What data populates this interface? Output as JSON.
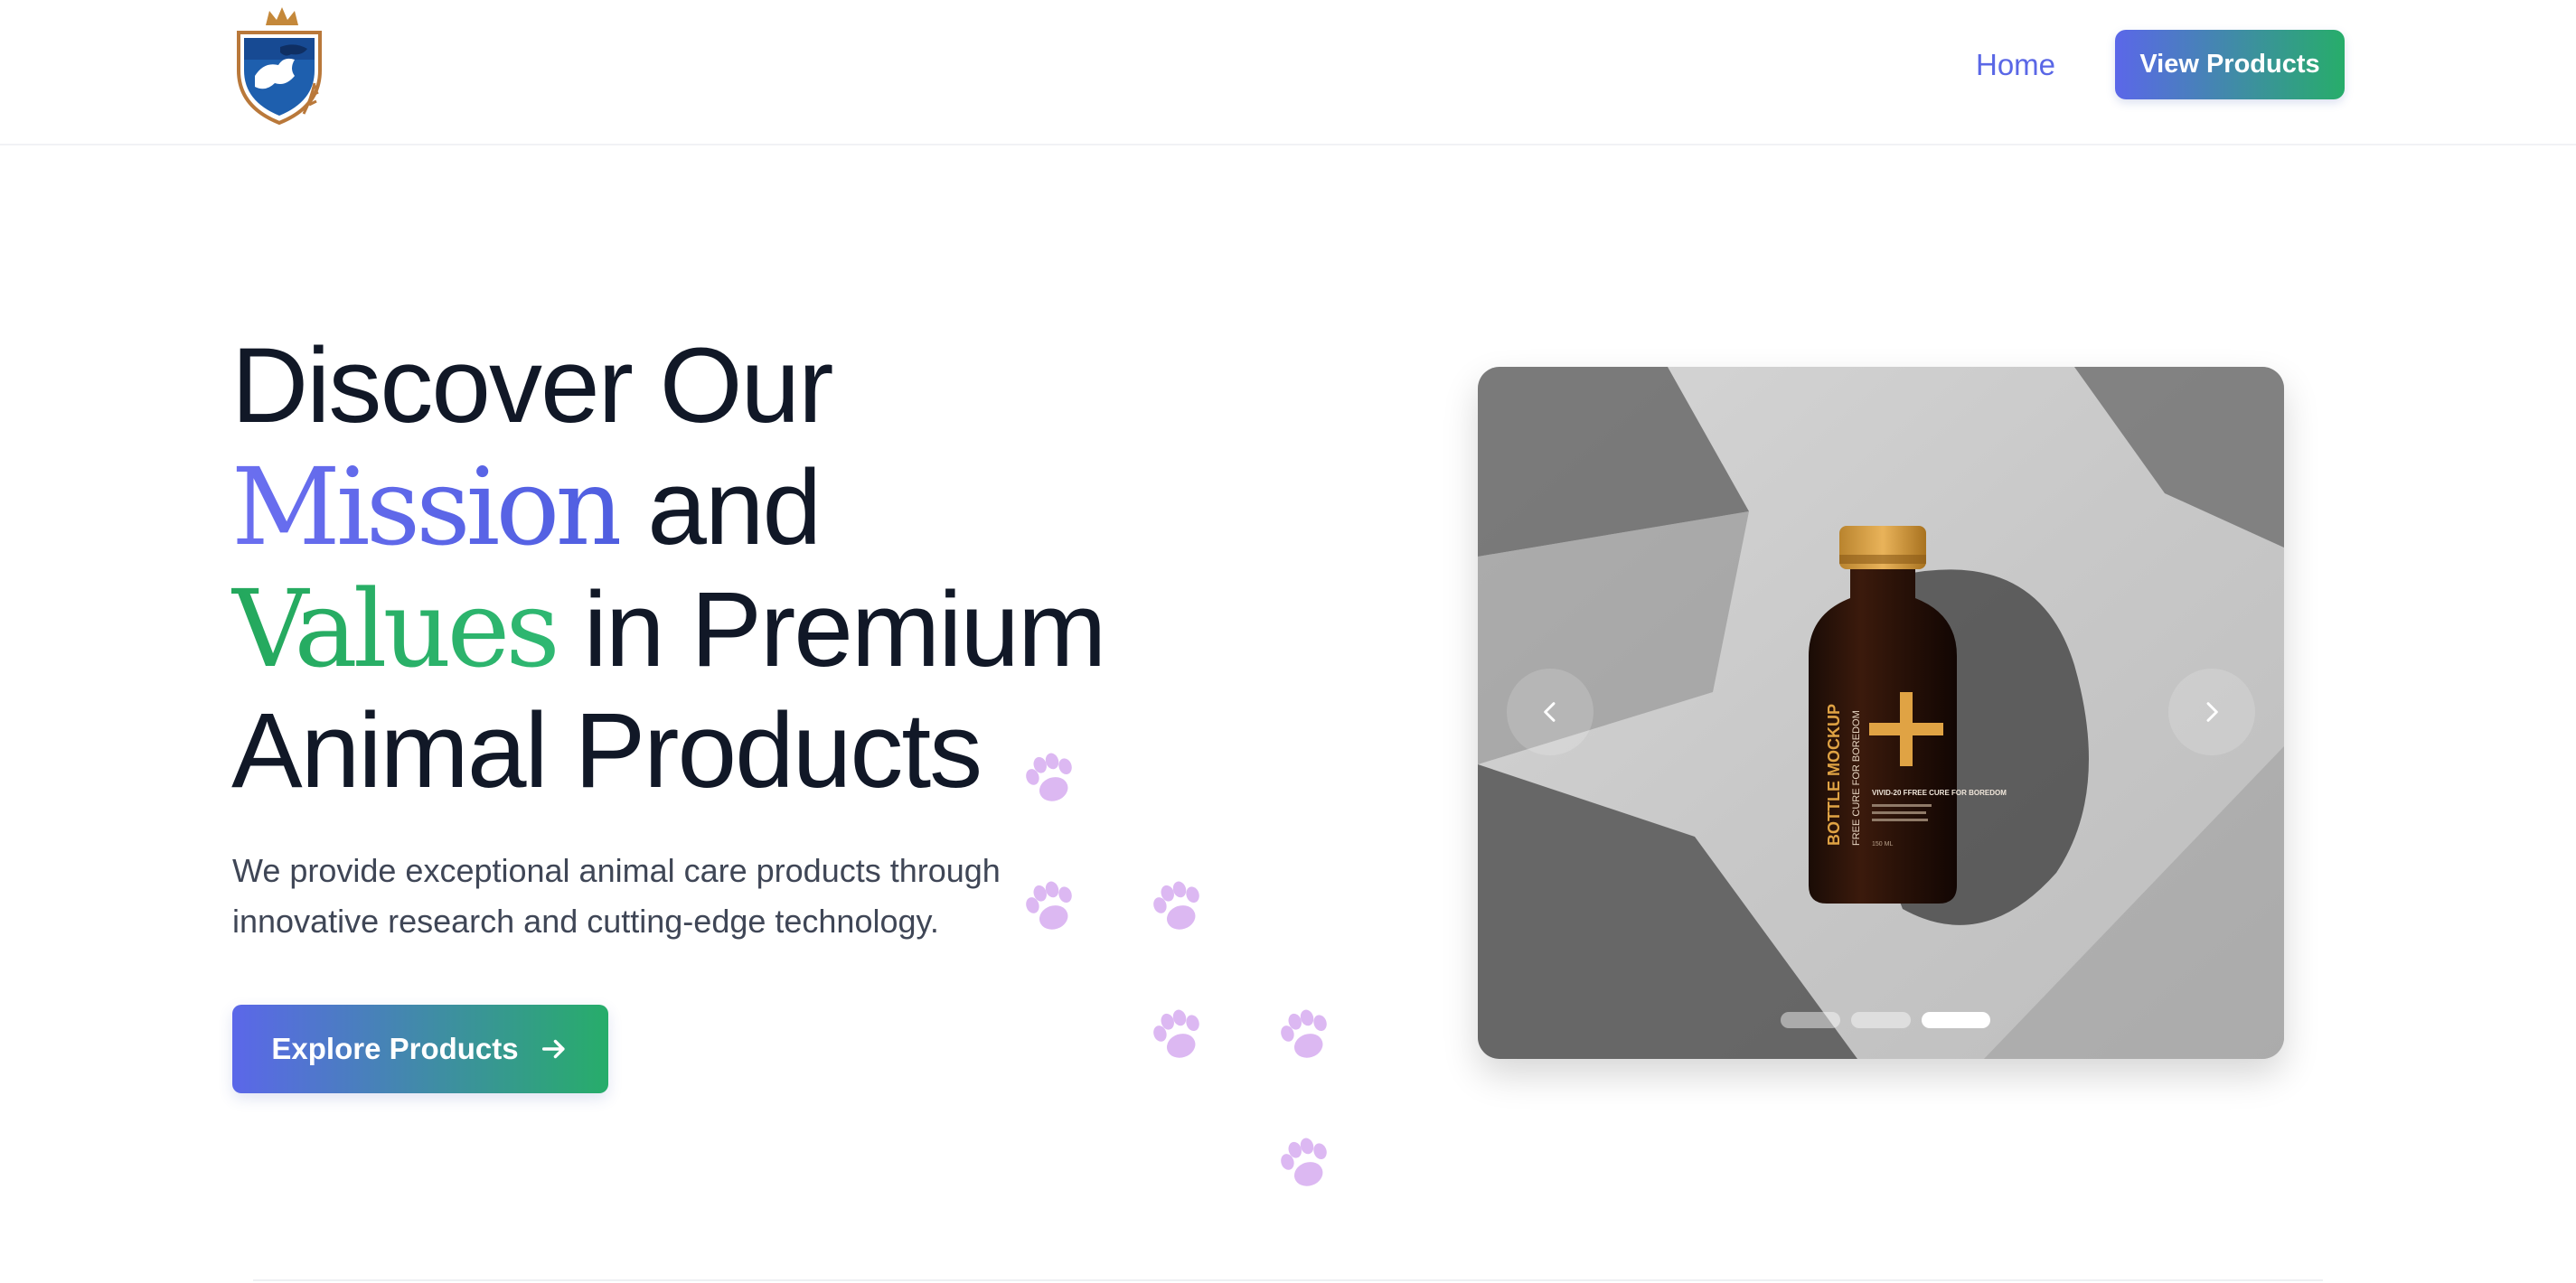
{
  "header": {
    "logo_alt": "Brand crest",
    "nav": {
      "home_label": "Home",
      "cta_label": "View Products"
    }
  },
  "hero": {
    "title": {
      "line1": "Discover Our",
      "word_mission": "Mission",
      "word_and": " and",
      "word_values": "Values",
      "word_in_premium": " in Premium",
      "line4": "Animal Products"
    },
    "description": "We provide exceptional animal care products through innovative research and cutting-edge technology.",
    "cta_label": "Explore Products"
  },
  "carousel": {
    "bottle": {
      "label_main": "BOTTLE MOCKUP",
      "label_sub": "FREE CURE FOR BOREDOM",
      "side_title": "VIVID-20 FFREE CURE FOR BOREDOM",
      "size": "150 ML"
    },
    "slide_count": 3,
    "active_slide": 3
  },
  "colors": {
    "brand_blue": "#5b67e9",
    "brand_green": "#27ad6a",
    "heading": "#111827",
    "body_text": "#3f4656",
    "paw": "#dcb8f2"
  },
  "icons": {
    "logo": "crest-icon",
    "explore_arrow": "arrow-right-icon",
    "carousel_prev": "chevron-left-icon",
    "carousel_next": "chevron-right-icon",
    "decor": "paw-icon"
  }
}
